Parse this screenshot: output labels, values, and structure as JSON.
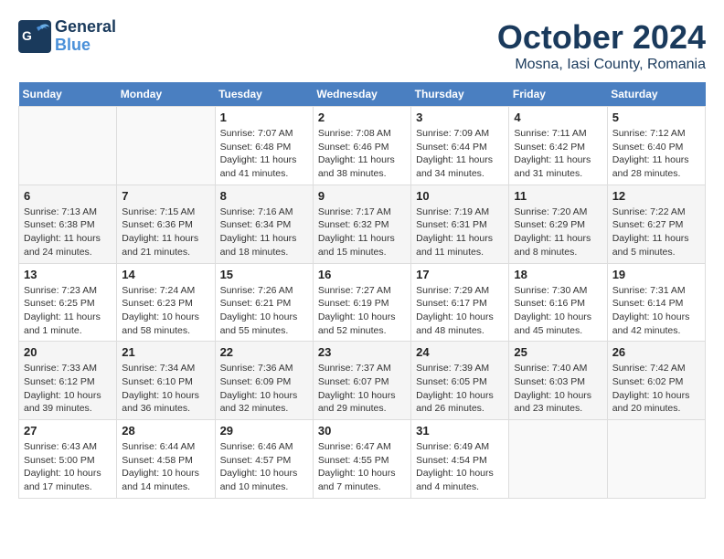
{
  "header": {
    "logo_general": "General",
    "logo_blue": "Blue",
    "month": "October 2024",
    "location": "Mosna, Iasi County, Romania"
  },
  "days_of_week": [
    "Sunday",
    "Monday",
    "Tuesday",
    "Wednesday",
    "Thursday",
    "Friday",
    "Saturday"
  ],
  "weeks": [
    [
      {
        "day": "",
        "info": ""
      },
      {
        "day": "",
        "info": ""
      },
      {
        "day": "1",
        "info": "Sunrise: 7:07 AM\nSunset: 6:48 PM\nDaylight: 11 hours and 41 minutes."
      },
      {
        "day": "2",
        "info": "Sunrise: 7:08 AM\nSunset: 6:46 PM\nDaylight: 11 hours and 38 minutes."
      },
      {
        "day": "3",
        "info": "Sunrise: 7:09 AM\nSunset: 6:44 PM\nDaylight: 11 hours and 34 minutes."
      },
      {
        "day": "4",
        "info": "Sunrise: 7:11 AM\nSunset: 6:42 PM\nDaylight: 11 hours and 31 minutes."
      },
      {
        "day": "5",
        "info": "Sunrise: 7:12 AM\nSunset: 6:40 PM\nDaylight: 11 hours and 28 minutes."
      }
    ],
    [
      {
        "day": "6",
        "info": "Sunrise: 7:13 AM\nSunset: 6:38 PM\nDaylight: 11 hours and 24 minutes."
      },
      {
        "day": "7",
        "info": "Sunrise: 7:15 AM\nSunset: 6:36 PM\nDaylight: 11 hours and 21 minutes."
      },
      {
        "day": "8",
        "info": "Sunrise: 7:16 AM\nSunset: 6:34 PM\nDaylight: 11 hours and 18 minutes."
      },
      {
        "day": "9",
        "info": "Sunrise: 7:17 AM\nSunset: 6:32 PM\nDaylight: 11 hours and 15 minutes."
      },
      {
        "day": "10",
        "info": "Sunrise: 7:19 AM\nSunset: 6:31 PM\nDaylight: 11 hours and 11 minutes."
      },
      {
        "day": "11",
        "info": "Sunrise: 7:20 AM\nSunset: 6:29 PM\nDaylight: 11 hours and 8 minutes."
      },
      {
        "day": "12",
        "info": "Sunrise: 7:22 AM\nSunset: 6:27 PM\nDaylight: 11 hours and 5 minutes."
      }
    ],
    [
      {
        "day": "13",
        "info": "Sunrise: 7:23 AM\nSunset: 6:25 PM\nDaylight: 11 hours and 1 minute."
      },
      {
        "day": "14",
        "info": "Sunrise: 7:24 AM\nSunset: 6:23 PM\nDaylight: 10 hours and 58 minutes."
      },
      {
        "day": "15",
        "info": "Sunrise: 7:26 AM\nSunset: 6:21 PM\nDaylight: 10 hours and 55 minutes."
      },
      {
        "day": "16",
        "info": "Sunrise: 7:27 AM\nSunset: 6:19 PM\nDaylight: 10 hours and 52 minutes."
      },
      {
        "day": "17",
        "info": "Sunrise: 7:29 AM\nSunset: 6:17 PM\nDaylight: 10 hours and 48 minutes."
      },
      {
        "day": "18",
        "info": "Sunrise: 7:30 AM\nSunset: 6:16 PM\nDaylight: 10 hours and 45 minutes."
      },
      {
        "day": "19",
        "info": "Sunrise: 7:31 AM\nSunset: 6:14 PM\nDaylight: 10 hours and 42 minutes."
      }
    ],
    [
      {
        "day": "20",
        "info": "Sunrise: 7:33 AM\nSunset: 6:12 PM\nDaylight: 10 hours and 39 minutes."
      },
      {
        "day": "21",
        "info": "Sunrise: 7:34 AM\nSunset: 6:10 PM\nDaylight: 10 hours and 36 minutes."
      },
      {
        "day": "22",
        "info": "Sunrise: 7:36 AM\nSunset: 6:09 PM\nDaylight: 10 hours and 32 minutes."
      },
      {
        "day": "23",
        "info": "Sunrise: 7:37 AM\nSunset: 6:07 PM\nDaylight: 10 hours and 29 minutes."
      },
      {
        "day": "24",
        "info": "Sunrise: 7:39 AM\nSunset: 6:05 PM\nDaylight: 10 hours and 26 minutes."
      },
      {
        "day": "25",
        "info": "Sunrise: 7:40 AM\nSunset: 6:03 PM\nDaylight: 10 hours and 23 minutes."
      },
      {
        "day": "26",
        "info": "Sunrise: 7:42 AM\nSunset: 6:02 PM\nDaylight: 10 hours and 20 minutes."
      }
    ],
    [
      {
        "day": "27",
        "info": "Sunrise: 6:43 AM\nSunset: 5:00 PM\nDaylight: 10 hours and 17 minutes."
      },
      {
        "day": "28",
        "info": "Sunrise: 6:44 AM\nSunset: 4:58 PM\nDaylight: 10 hours and 14 minutes."
      },
      {
        "day": "29",
        "info": "Sunrise: 6:46 AM\nSunset: 4:57 PM\nDaylight: 10 hours and 10 minutes."
      },
      {
        "day": "30",
        "info": "Sunrise: 6:47 AM\nSunset: 4:55 PM\nDaylight: 10 hours and 7 minutes."
      },
      {
        "day": "31",
        "info": "Sunrise: 6:49 AM\nSunset: 4:54 PM\nDaylight: 10 hours and 4 minutes."
      },
      {
        "day": "",
        "info": ""
      },
      {
        "day": "",
        "info": ""
      }
    ]
  ]
}
